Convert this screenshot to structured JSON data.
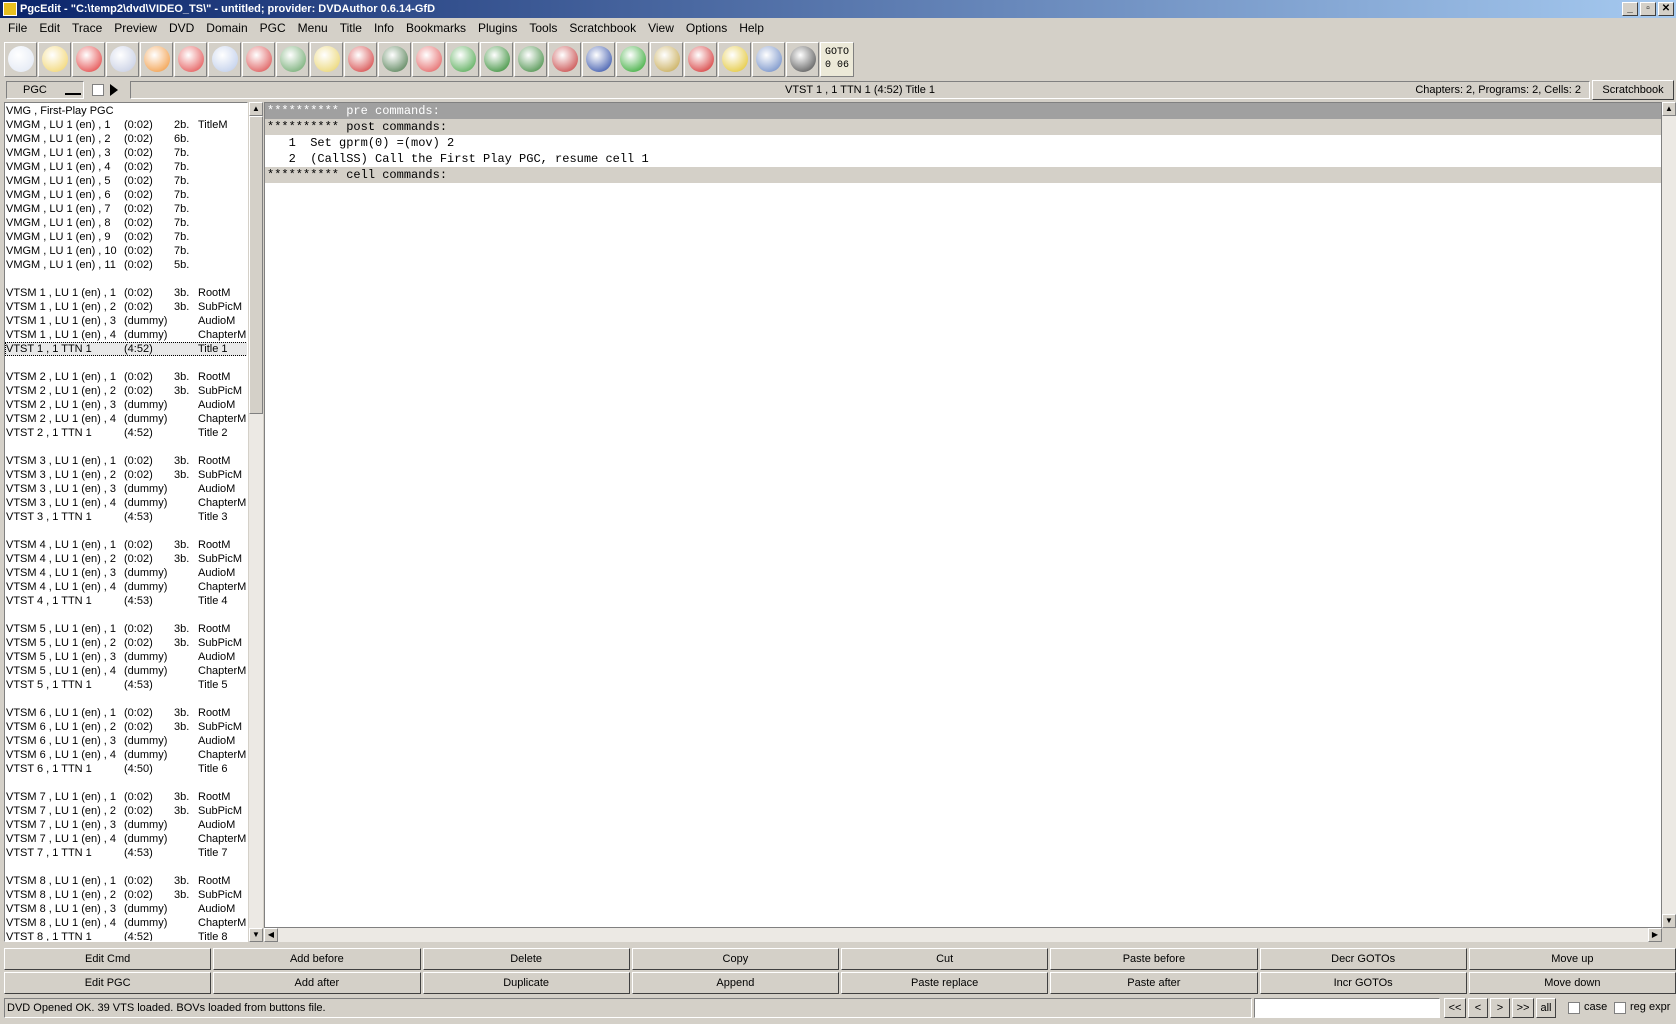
{
  "window": {
    "title": "PgcEdit -   \"C:\\temp2\\dvd\\VIDEO_TS\\\" - untitled; provider: DVDAuthor 0.6.14-GfD",
    "min": "_",
    "max": "▫",
    "close": "✕"
  },
  "menu": [
    "File",
    "Edit",
    "Trace",
    "Preview",
    "DVD",
    "Domain",
    "PGC",
    "Menu",
    "Title",
    "Info",
    "Bookmarks",
    "Plugins",
    "Tools",
    "Scratchbook",
    "View",
    "Options",
    "Help"
  ],
  "toolbar": {
    "icons": [
      {
        "name": "open-dvd-icon",
        "color": "#dfe6f3"
      },
      {
        "name": "open-folder-icon",
        "color": "#f0d060"
      },
      {
        "name": "reload-icon",
        "color": "#e03030"
      },
      {
        "name": "new-dvd-icon",
        "color": "#c0c8e0"
      },
      {
        "name": "home-icon",
        "color": "#f09030"
      },
      {
        "name": "search-icon",
        "color": "#e04040"
      },
      {
        "name": "disc-compare-icon",
        "color": "#b8c8e8"
      },
      {
        "name": "disc-edit-icon",
        "color": "#d84040"
      },
      {
        "name": "document-green-icon",
        "color": "#60a060"
      },
      {
        "name": "folder-yellow-icon",
        "color": "#e8d060"
      },
      {
        "name": "checkmark-disc-icon",
        "color": "#d03030"
      },
      {
        "name": "disc-3d-icon",
        "color": "#407040"
      },
      {
        "name": "copy-pages-icon",
        "color": "#e05050"
      },
      {
        "name": "globe-icon",
        "color": "#40a040"
      },
      {
        "name": "play-movie-icon",
        "color": "#208020"
      },
      {
        "name": "turtle-icon",
        "color": "#308030"
      },
      {
        "name": "film-strip-icon",
        "color": "#c03030"
      },
      {
        "name": "cross-film-icon",
        "color": "#2040a0"
      },
      {
        "name": "menu-icon",
        "color": "#20a020"
      },
      {
        "name": "chain-link-icon",
        "color": "#c0a040"
      },
      {
        "name": "numbers-search-icon",
        "color": "#d02020"
      },
      {
        "name": "tcl-icon",
        "color": "#e0c020"
      },
      {
        "name": "eye-icon",
        "color": "#6080c0"
      },
      {
        "name": "jump-arrow-icon",
        "color": "#404040"
      }
    ],
    "goto": {
      "label": "GOTO",
      "value": "0 06"
    }
  },
  "pgcbar": {
    "select": "PGC",
    "current": "VTST 1 , 1    TTN 1  (4:52)  Title 1",
    "summary": "Chapters: 2,  Programs: 2,  Cells: 2",
    "scratchbook": "Scratchbook"
  },
  "pgclist": [
    {
      "c1": "VMG , First-Play PGC",
      "c2": "",
      "c3": "",
      "c4": ""
    },
    {
      "c1": "VMGM , LU 1 (en) , 1",
      "c2": "(0:02)",
      "c3": "2b.",
      "c4": "TitleM"
    },
    {
      "c1": "VMGM , LU 1 (en) , 2",
      "c2": "(0:02)",
      "c3": "6b.",
      "c4": ""
    },
    {
      "c1": "VMGM , LU 1 (en) , 3",
      "c2": "(0:02)",
      "c3": "7b.",
      "c4": ""
    },
    {
      "c1": "VMGM , LU 1 (en) , 4",
      "c2": "(0:02)",
      "c3": "7b.",
      "c4": ""
    },
    {
      "c1": "VMGM , LU 1 (en) , 5",
      "c2": "(0:02)",
      "c3": "7b.",
      "c4": ""
    },
    {
      "c1": "VMGM , LU 1 (en) , 6",
      "c2": "(0:02)",
      "c3": "7b.",
      "c4": ""
    },
    {
      "c1": "VMGM , LU 1 (en) , 7",
      "c2": "(0:02)",
      "c3": "7b.",
      "c4": ""
    },
    {
      "c1": "VMGM , LU 1 (en) , 8",
      "c2": "(0:02)",
      "c3": "7b.",
      "c4": ""
    },
    {
      "c1": "VMGM , LU 1 (en) , 9",
      "c2": "(0:02)",
      "c3": "7b.",
      "c4": ""
    },
    {
      "c1": "VMGM , LU 1 (en) , 10",
      "c2": "(0:02)",
      "c3": "7b.",
      "c4": ""
    },
    {
      "c1": "VMGM , LU 1 (en) , 11",
      "c2": "(0:02)",
      "c3": "5b.",
      "c4": ""
    },
    {
      "c1": "",
      "c2": "",
      "c3": "",
      "c4": ""
    },
    {
      "c1": "VTSM 1 , LU 1 (en) , 1",
      "c2": "(0:02)",
      "c3": "3b.",
      "c4": "RootM"
    },
    {
      "c1": "VTSM 1 , LU 1 (en) , 2",
      "c2": "(0:02)",
      "c3": "3b.",
      "c4": "SubPicM"
    },
    {
      "c1": "VTSM 1 , LU 1 (en) , 3",
      "c2": "(dummy)",
      "c3": "",
      "c4": "AudioM"
    },
    {
      "c1": "VTSM 1 , LU 1 (en) , 4",
      "c2": "(dummy)",
      "c3": "",
      "c4": "ChapterM"
    },
    {
      "c1": "VTST 1 , 1      TTN 1",
      "c2": "(4:52)",
      "c3": "",
      "c4": "Title 1",
      "selected": true
    },
    {
      "c1": "",
      "c2": "",
      "c3": "",
      "c4": ""
    },
    {
      "c1": "VTSM 2 , LU 1 (en) , 1",
      "c2": "(0:02)",
      "c3": "3b.",
      "c4": "RootM"
    },
    {
      "c1": "VTSM 2 , LU 1 (en) , 2",
      "c2": "(0:02)",
      "c3": "3b.",
      "c4": "SubPicM"
    },
    {
      "c1": "VTSM 2 , LU 1 (en) , 3",
      "c2": "(dummy)",
      "c3": "",
      "c4": "AudioM"
    },
    {
      "c1": "VTSM 2 , LU 1 (en) , 4",
      "c2": "(dummy)",
      "c3": "",
      "c4": "ChapterM"
    },
    {
      "c1": "VTST 2 , 1      TTN 1",
      "c2": "(4:52)",
      "c3": "",
      "c4": "Title 2"
    },
    {
      "c1": "",
      "c2": "",
      "c3": "",
      "c4": ""
    },
    {
      "c1": "VTSM 3 , LU 1 (en) , 1",
      "c2": "(0:02)",
      "c3": "3b.",
      "c4": "RootM"
    },
    {
      "c1": "VTSM 3 , LU 1 (en) , 2",
      "c2": "(0:02)",
      "c3": "3b.",
      "c4": "SubPicM"
    },
    {
      "c1": "VTSM 3 , LU 1 (en) , 3",
      "c2": "(dummy)",
      "c3": "",
      "c4": "AudioM"
    },
    {
      "c1": "VTSM 3 , LU 1 (en) , 4",
      "c2": "(dummy)",
      "c3": "",
      "c4": "ChapterM"
    },
    {
      "c1": "VTST 3 , 1      TTN 1",
      "c2": "(4:53)",
      "c3": "",
      "c4": "Title 3"
    },
    {
      "c1": "",
      "c2": "",
      "c3": "",
      "c4": ""
    },
    {
      "c1": "VTSM 4 , LU 1 (en) , 1",
      "c2": "(0:02)",
      "c3": "3b.",
      "c4": "RootM"
    },
    {
      "c1": "VTSM 4 , LU 1 (en) , 2",
      "c2": "(0:02)",
      "c3": "3b.",
      "c4": "SubPicM"
    },
    {
      "c1": "VTSM 4 , LU 1 (en) , 3",
      "c2": "(dummy)",
      "c3": "",
      "c4": "AudioM"
    },
    {
      "c1": "VTSM 4 , LU 1 (en) , 4",
      "c2": "(dummy)",
      "c3": "",
      "c4": "ChapterM"
    },
    {
      "c1": "VTST 4 , 1      TTN 1",
      "c2": "(4:53)",
      "c3": "",
      "c4": "Title 4"
    },
    {
      "c1": "",
      "c2": "",
      "c3": "",
      "c4": ""
    },
    {
      "c1": "VTSM 5 , LU 1 (en) , 1",
      "c2": "(0:02)",
      "c3": "3b.",
      "c4": "RootM"
    },
    {
      "c1": "VTSM 5 , LU 1 (en) , 2",
      "c2": "(0:02)",
      "c3": "3b.",
      "c4": "SubPicM"
    },
    {
      "c1": "VTSM 5 , LU 1 (en) , 3",
      "c2": "(dummy)",
      "c3": "",
      "c4": "AudioM"
    },
    {
      "c1": "VTSM 5 , LU 1 (en) , 4",
      "c2": "(dummy)",
      "c3": "",
      "c4": "ChapterM"
    },
    {
      "c1": "VTST 5 , 1      TTN 1",
      "c2": "(4:53)",
      "c3": "",
      "c4": "Title 5"
    },
    {
      "c1": "",
      "c2": "",
      "c3": "",
      "c4": ""
    },
    {
      "c1": "VTSM 6 , LU 1 (en) , 1",
      "c2": "(0:02)",
      "c3": "3b.",
      "c4": "RootM"
    },
    {
      "c1": "VTSM 6 , LU 1 (en) , 2",
      "c2": "(0:02)",
      "c3": "3b.",
      "c4": "SubPicM"
    },
    {
      "c1": "VTSM 6 , LU 1 (en) , 3",
      "c2": "(dummy)",
      "c3": "",
      "c4": "AudioM"
    },
    {
      "c1": "VTSM 6 , LU 1 (en) , 4",
      "c2": "(dummy)",
      "c3": "",
      "c4": "ChapterM"
    },
    {
      "c1": "VTST 6 , 1      TTN 1",
      "c2": "(4:50)",
      "c3": "",
      "c4": "Title 6"
    },
    {
      "c1": "",
      "c2": "",
      "c3": "",
      "c4": ""
    },
    {
      "c1": "VTSM 7 , LU 1 (en) , 1",
      "c2": "(0:02)",
      "c3": "3b.",
      "c4": "RootM"
    },
    {
      "c1": "VTSM 7 , LU 1 (en) , 2",
      "c2": "(0:02)",
      "c3": "3b.",
      "c4": "SubPicM"
    },
    {
      "c1": "VTSM 7 , LU 1 (en) , 3",
      "c2": "(dummy)",
      "c3": "",
      "c4": "AudioM"
    },
    {
      "c1": "VTSM 7 , LU 1 (en) , 4",
      "c2": "(dummy)",
      "c3": "",
      "c4": "ChapterM"
    },
    {
      "c1": "VTST 7 , 1      TTN 1",
      "c2": "(4:53)",
      "c3": "",
      "c4": "Title 7"
    },
    {
      "c1": "",
      "c2": "",
      "c3": "",
      "c4": ""
    },
    {
      "c1": "VTSM 8 , LU 1 (en) , 1",
      "c2": "(0:02)",
      "c3": "3b.",
      "c4": "RootM"
    },
    {
      "c1": "VTSM 8 , LU 1 (en) , 2",
      "c2": "(0:02)",
      "c3": "3b.",
      "c4": "SubPicM"
    },
    {
      "c1": "VTSM 8 , LU 1 (en) , 3",
      "c2": "(dummy)",
      "c3": "",
      "c4": "AudioM"
    },
    {
      "c1": "VTSM 8 , LU 1 (en) , 4",
      "c2": "(dummy)",
      "c3": "",
      "c4": "ChapterM"
    },
    {
      "c1": "VTST 8 , 1      TTN 1",
      "c2": "(4:52)",
      "c3": "",
      "c4": "Title 8"
    }
  ],
  "commands": [
    {
      "text": "********** pre commands:",
      "kind": "hdr"
    },
    {
      "text": "********** post commands:",
      "kind": "hdr2"
    },
    {
      "text": "   1  Set gprm(0) =(mov) 2",
      "kind": "cmd"
    },
    {
      "text": "   2  (CallSS) Call the First Play PGC, resume cell 1",
      "kind": "cmd"
    },
    {
      "text": "********** cell commands:",
      "kind": "hdr2"
    }
  ],
  "buttons": {
    "row1": [
      "Edit Cmd",
      "Add before",
      "Delete",
      "Copy",
      "Cut",
      "Paste before",
      "Decr GOTOs",
      "Move up"
    ],
    "row2": [
      "Edit PGC",
      "Add after",
      "Duplicate",
      "Append",
      "Paste replace",
      "Paste after",
      "Incr GOTOs",
      "Move down"
    ]
  },
  "status": {
    "text": "DVD Opened OK.  39 VTS loaded.  BOVs loaded from buttons file.",
    "search_value": "",
    "nav": [
      "<<",
      "<",
      ">",
      ">>",
      "all"
    ],
    "case_label": "case",
    "regex_label": "reg expr"
  }
}
